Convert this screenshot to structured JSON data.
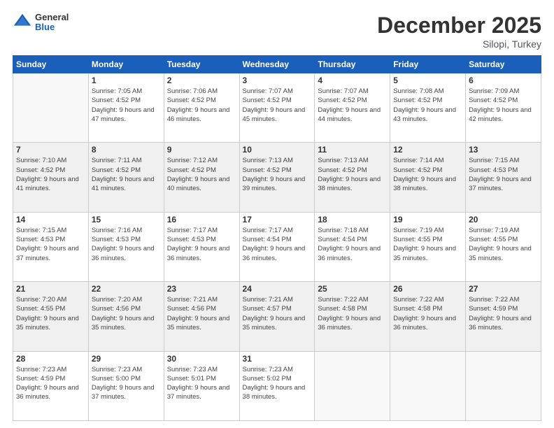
{
  "header": {
    "logo_general": "General",
    "logo_blue": "Blue",
    "month": "December 2025",
    "location": "Silopi, Turkey"
  },
  "weekdays": [
    "Sunday",
    "Monday",
    "Tuesday",
    "Wednesday",
    "Thursday",
    "Friday",
    "Saturday"
  ],
  "weeks": [
    [
      {
        "day": "",
        "sunrise": "",
        "sunset": "",
        "daylight": ""
      },
      {
        "day": "1",
        "sunrise": "Sunrise: 7:05 AM",
        "sunset": "Sunset: 4:52 PM",
        "daylight": "Daylight: 9 hours and 47 minutes."
      },
      {
        "day": "2",
        "sunrise": "Sunrise: 7:06 AM",
        "sunset": "Sunset: 4:52 PM",
        "daylight": "Daylight: 9 hours and 46 minutes."
      },
      {
        "day": "3",
        "sunrise": "Sunrise: 7:07 AM",
        "sunset": "Sunset: 4:52 PM",
        "daylight": "Daylight: 9 hours and 45 minutes."
      },
      {
        "day": "4",
        "sunrise": "Sunrise: 7:07 AM",
        "sunset": "Sunset: 4:52 PM",
        "daylight": "Daylight: 9 hours and 44 minutes."
      },
      {
        "day": "5",
        "sunrise": "Sunrise: 7:08 AM",
        "sunset": "Sunset: 4:52 PM",
        "daylight": "Daylight: 9 hours and 43 minutes."
      },
      {
        "day": "6",
        "sunrise": "Sunrise: 7:09 AM",
        "sunset": "Sunset: 4:52 PM",
        "daylight": "Daylight: 9 hours and 42 minutes."
      }
    ],
    [
      {
        "day": "7",
        "sunrise": "Sunrise: 7:10 AM",
        "sunset": "Sunset: 4:52 PM",
        "daylight": "Daylight: 9 hours and 41 minutes."
      },
      {
        "day": "8",
        "sunrise": "Sunrise: 7:11 AM",
        "sunset": "Sunset: 4:52 PM",
        "daylight": "Daylight: 9 hours and 41 minutes."
      },
      {
        "day": "9",
        "sunrise": "Sunrise: 7:12 AM",
        "sunset": "Sunset: 4:52 PM",
        "daylight": "Daylight: 9 hours and 40 minutes."
      },
      {
        "day": "10",
        "sunrise": "Sunrise: 7:13 AM",
        "sunset": "Sunset: 4:52 PM",
        "daylight": "Daylight: 9 hours and 39 minutes."
      },
      {
        "day": "11",
        "sunrise": "Sunrise: 7:13 AM",
        "sunset": "Sunset: 4:52 PM",
        "daylight": "Daylight: 9 hours and 38 minutes."
      },
      {
        "day": "12",
        "sunrise": "Sunrise: 7:14 AM",
        "sunset": "Sunset: 4:52 PM",
        "daylight": "Daylight: 9 hours and 38 minutes."
      },
      {
        "day": "13",
        "sunrise": "Sunrise: 7:15 AM",
        "sunset": "Sunset: 4:53 PM",
        "daylight": "Daylight: 9 hours and 37 minutes."
      }
    ],
    [
      {
        "day": "14",
        "sunrise": "Sunrise: 7:15 AM",
        "sunset": "Sunset: 4:53 PM",
        "daylight": "Daylight: 9 hours and 37 minutes."
      },
      {
        "day": "15",
        "sunrise": "Sunrise: 7:16 AM",
        "sunset": "Sunset: 4:53 PM",
        "daylight": "Daylight: 9 hours and 36 minutes."
      },
      {
        "day": "16",
        "sunrise": "Sunrise: 7:17 AM",
        "sunset": "Sunset: 4:53 PM",
        "daylight": "Daylight: 9 hours and 36 minutes."
      },
      {
        "day": "17",
        "sunrise": "Sunrise: 7:17 AM",
        "sunset": "Sunset: 4:54 PM",
        "daylight": "Daylight: 9 hours and 36 minutes."
      },
      {
        "day": "18",
        "sunrise": "Sunrise: 7:18 AM",
        "sunset": "Sunset: 4:54 PM",
        "daylight": "Daylight: 9 hours and 36 minutes."
      },
      {
        "day": "19",
        "sunrise": "Sunrise: 7:19 AM",
        "sunset": "Sunset: 4:55 PM",
        "daylight": "Daylight: 9 hours and 35 minutes."
      },
      {
        "day": "20",
        "sunrise": "Sunrise: 7:19 AM",
        "sunset": "Sunset: 4:55 PM",
        "daylight": "Daylight: 9 hours and 35 minutes."
      }
    ],
    [
      {
        "day": "21",
        "sunrise": "Sunrise: 7:20 AM",
        "sunset": "Sunset: 4:55 PM",
        "daylight": "Daylight: 9 hours and 35 minutes."
      },
      {
        "day": "22",
        "sunrise": "Sunrise: 7:20 AM",
        "sunset": "Sunset: 4:56 PM",
        "daylight": "Daylight: 9 hours and 35 minutes."
      },
      {
        "day": "23",
        "sunrise": "Sunrise: 7:21 AM",
        "sunset": "Sunset: 4:56 PM",
        "daylight": "Daylight: 9 hours and 35 minutes."
      },
      {
        "day": "24",
        "sunrise": "Sunrise: 7:21 AM",
        "sunset": "Sunset: 4:57 PM",
        "daylight": "Daylight: 9 hours and 35 minutes."
      },
      {
        "day": "25",
        "sunrise": "Sunrise: 7:22 AM",
        "sunset": "Sunset: 4:58 PM",
        "daylight": "Daylight: 9 hours and 36 minutes."
      },
      {
        "day": "26",
        "sunrise": "Sunrise: 7:22 AM",
        "sunset": "Sunset: 4:58 PM",
        "daylight": "Daylight: 9 hours and 36 minutes."
      },
      {
        "day": "27",
        "sunrise": "Sunrise: 7:22 AM",
        "sunset": "Sunset: 4:59 PM",
        "daylight": "Daylight: 9 hours and 36 minutes."
      }
    ],
    [
      {
        "day": "28",
        "sunrise": "Sunrise: 7:23 AM",
        "sunset": "Sunset: 4:59 PM",
        "daylight": "Daylight: 9 hours and 36 minutes."
      },
      {
        "day": "29",
        "sunrise": "Sunrise: 7:23 AM",
        "sunset": "Sunset: 5:00 PM",
        "daylight": "Daylight: 9 hours and 37 minutes."
      },
      {
        "day": "30",
        "sunrise": "Sunrise: 7:23 AM",
        "sunset": "Sunset: 5:01 PM",
        "daylight": "Daylight: 9 hours and 37 minutes."
      },
      {
        "day": "31",
        "sunrise": "Sunrise: 7:23 AM",
        "sunset": "Sunset: 5:02 PM",
        "daylight": "Daylight: 9 hours and 38 minutes."
      },
      {
        "day": "",
        "sunrise": "",
        "sunset": "",
        "daylight": ""
      },
      {
        "day": "",
        "sunrise": "",
        "sunset": "",
        "daylight": ""
      },
      {
        "day": "",
        "sunrise": "",
        "sunset": "",
        "daylight": ""
      }
    ]
  ]
}
